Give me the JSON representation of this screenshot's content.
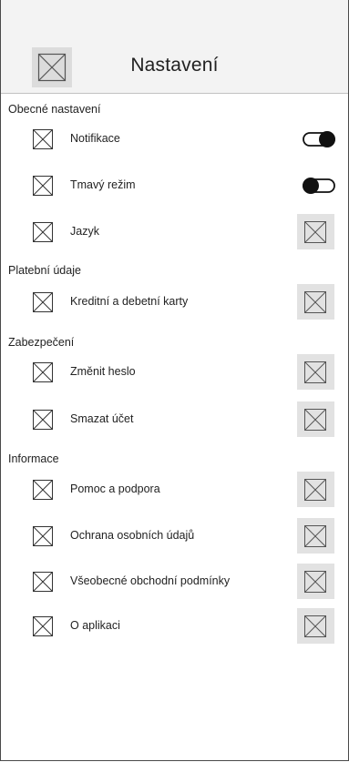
{
  "header": {
    "title": "Nastavení",
    "back_icon": "back-icon"
  },
  "sections": {
    "general": {
      "title": "Obecné nastavení",
      "items": [
        {
          "label": "Notifikace",
          "control": "toggle",
          "on": true
        },
        {
          "label": "Tmavý režim",
          "control": "toggle",
          "on": false
        },
        {
          "label": "Jazyk",
          "control": "chevron"
        }
      ]
    },
    "payment": {
      "title": "Platební údaje",
      "items": [
        {
          "label": "Kreditní a debetní karty",
          "control": "chevron"
        }
      ]
    },
    "security": {
      "title": "Zabezpečení",
      "items": [
        {
          "label": "Změnit heslo",
          "control": "chevron"
        },
        {
          "label": "Smazat účet",
          "control": "chevron"
        }
      ]
    },
    "info": {
      "title": "Informace",
      "items": [
        {
          "label": "Pomoc a podpora",
          "control": "chevron"
        },
        {
          "label": "Ochrana osobních údajů",
          "control": "chevron"
        },
        {
          "label": "Všeobecné obchodní podmínky",
          "control": "chevron"
        },
        {
          "label": "O aplikaci",
          "control": "chevron"
        }
      ]
    }
  },
  "colors": {
    "background": "#ffffff",
    "header_bg": "#f3f3f3",
    "placeholder": "#e2e2e2",
    "toggle": "#111111"
  }
}
